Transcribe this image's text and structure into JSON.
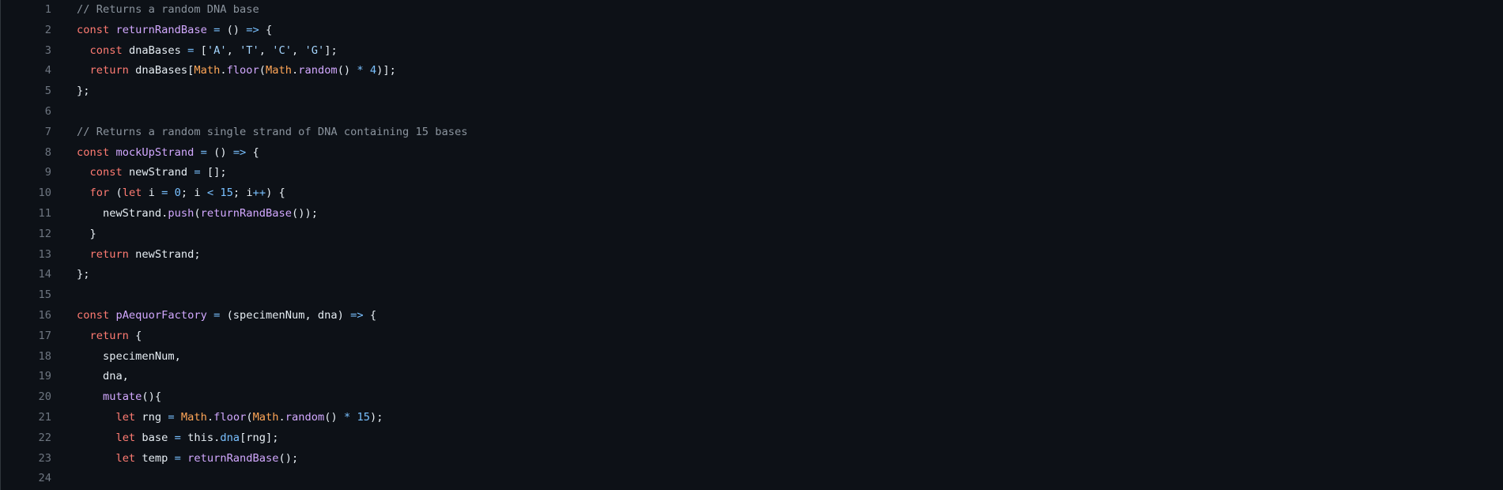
{
  "colors": {
    "background": "#0d1117",
    "keyword": "#ff7b72",
    "function": "#d2a8ff",
    "comment": "#8b949e",
    "string": "#a5d6ff",
    "number": "#79c0ff",
    "object": "#ffa657",
    "text": "#e6edf3",
    "line_number": "#6e7681"
  },
  "lines": [
    {
      "n": "1",
      "tokens": [
        [
          "cm",
          "// Returns a random DNA base"
        ]
      ]
    },
    {
      "n": "2",
      "tokens": [
        [
          "kw",
          "const "
        ],
        [
          "fn",
          "returnRandBase"
        ],
        [
          "op",
          " = "
        ],
        [
          "tx",
          "() "
        ],
        [
          "op",
          "=>"
        ],
        [
          "tx",
          " {"
        ]
      ]
    },
    {
      "n": "3",
      "tokens": [
        [
          "tx",
          "  "
        ],
        [
          "kw",
          "const "
        ],
        [
          "tx",
          "dnaBases "
        ],
        [
          "op",
          "="
        ],
        [
          "tx",
          " ["
        ],
        [
          "str",
          "'A'"
        ],
        [
          "tx",
          ", "
        ],
        [
          "str",
          "'T'"
        ],
        [
          "tx",
          ", "
        ],
        [
          "str",
          "'C'"
        ],
        [
          "tx",
          ", "
        ],
        [
          "str",
          "'G'"
        ],
        [
          "tx",
          "];"
        ]
      ]
    },
    {
      "n": "4",
      "tokens": [
        [
          "tx",
          "  "
        ],
        [
          "kw",
          "return "
        ],
        [
          "tx",
          "dnaBases["
        ],
        [
          "obj",
          "Math"
        ],
        [
          "tx",
          "."
        ],
        [
          "fn",
          "floor"
        ],
        [
          "tx",
          "("
        ],
        [
          "obj",
          "Math"
        ],
        [
          "tx",
          "."
        ],
        [
          "fn",
          "random"
        ],
        [
          "tx",
          "() "
        ],
        [
          "op",
          "*"
        ],
        [
          "tx",
          " "
        ],
        [
          "num",
          "4"
        ],
        [
          "tx",
          ")];"
        ]
      ]
    },
    {
      "n": "5",
      "tokens": [
        [
          "tx",
          "};"
        ]
      ]
    },
    {
      "n": "6",
      "tokens": []
    },
    {
      "n": "7",
      "tokens": [
        [
          "cm",
          "// Returns a random single strand of DNA containing 15 bases"
        ]
      ]
    },
    {
      "n": "8",
      "tokens": [
        [
          "kw",
          "const "
        ],
        [
          "fn",
          "mockUpStrand"
        ],
        [
          "op",
          " = "
        ],
        [
          "tx",
          "() "
        ],
        [
          "op",
          "=>"
        ],
        [
          "tx",
          " {"
        ]
      ]
    },
    {
      "n": "9",
      "tokens": [
        [
          "tx",
          "  "
        ],
        [
          "kw",
          "const "
        ],
        [
          "tx",
          "newStrand "
        ],
        [
          "op",
          "="
        ],
        [
          "tx",
          " [];"
        ]
      ]
    },
    {
      "n": "10",
      "tokens": [
        [
          "tx",
          "  "
        ],
        [
          "kw",
          "for"
        ],
        [
          "tx",
          " ("
        ],
        [
          "kw",
          "let "
        ],
        [
          "tx",
          "i "
        ],
        [
          "op",
          "="
        ],
        [
          "tx",
          " "
        ],
        [
          "num",
          "0"
        ],
        [
          "tx",
          "; i "
        ],
        [
          "op",
          "<"
        ],
        [
          "tx",
          " "
        ],
        [
          "num",
          "15"
        ],
        [
          "tx",
          "; i"
        ],
        [
          "op",
          "++"
        ],
        [
          "tx",
          ") {"
        ]
      ]
    },
    {
      "n": "11",
      "tokens": [
        [
          "tx",
          "    newStrand."
        ],
        [
          "fn",
          "push"
        ],
        [
          "tx",
          "("
        ],
        [
          "fn",
          "returnRandBase"
        ],
        [
          "tx",
          "());"
        ]
      ]
    },
    {
      "n": "12",
      "tokens": [
        [
          "tx",
          "  }"
        ]
      ]
    },
    {
      "n": "13",
      "tokens": [
        [
          "tx",
          "  "
        ],
        [
          "kw",
          "return "
        ],
        [
          "tx",
          "newStrand;"
        ]
      ]
    },
    {
      "n": "14",
      "tokens": [
        [
          "tx",
          "};"
        ]
      ]
    },
    {
      "n": "15",
      "tokens": []
    },
    {
      "n": "16",
      "tokens": [
        [
          "kw",
          "const "
        ],
        [
          "fn",
          "pAequorFactory"
        ],
        [
          "op",
          " = "
        ],
        [
          "tx",
          "(specimenNum, dna) "
        ],
        [
          "op",
          "=>"
        ],
        [
          "tx",
          " {"
        ]
      ]
    },
    {
      "n": "17",
      "tokens": [
        [
          "tx",
          "  "
        ],
        [
          "kw",
          "return"
        ],
        [
          "tx",
          " {"
        ]
      ]
    },
    {
      "n": "18",
      "tokens": [
        [
          "tx",
          "    specimenNum,"
        ]
      ]
    },
    {
      "n": "19",
      "tokens": [
        [
          "tx",
          "    dna,"
        ]
      ]
    },
    {
      "n": "20",
      "tokens": [
        [
          "tx",
          "    "
        ],
        [
          "fn",
          "mutate"
        ],
        [
          "tx",
          "(){"
        ]
      ]
    },
    {
      "n": "21",
      "tokens": [
        [
          "tx",
          "      "
        ],
        [
          "kw",
          "let "
        ],
        [
          "tx",
          "rng "
        ],
        [
          "op",
          "="
        ],
        [
          "tx",
          " "
        ],
        [
          "obj",
          "Math"
        ],
        [
          "tx",
          "."
        ],
        [
          "fn",
          "floor"
        ],
        [
          "tx",
          "("
        ],
        [
          "obj",
          "Math"
        ],
        [
          "tx",
          "."
        ],
        [
          "fn",
          "random"
        ],
        [
          "tx",
          "() "
        ],
        [
          "op",
          "*"
        ],
        [
          "tx",
          " "
        ],
        [
          "num",
          "15"
        ],
        [
          "tx",
          ");"
        ]
      ]
    },
    {
      "n": "22",
      "tokens": [
        [
          "tx",
          "      "
        ],
        [
          "kw",
          "let "
        ],
        [
          "tx",
          "base "
        ],
        [
          "op",
          "="
        ],
        [
          "tx",
          " this."
        ],
        [
          "prop",
          "dna"
        ],
        [
          "tx",
          "[rng];"
        ]
      ]
    },
    {
      "n": "23",
      "tokens": [
        [
          "tx",
          "      "
        ],
        [
          "kw",
          "let "
        ],
        [
          "tx",
          "temp "
        ],
        [
          "op",
          "="
        ],
        [
          "tx",
          " "
        ],
        [
          "fn",
          "returnRandBase"
        ],
        [
          "tx",
          "();"
        ]
      ]
    },
    {
      "n": "24",
      "tokens": []
    }
  ]
}
